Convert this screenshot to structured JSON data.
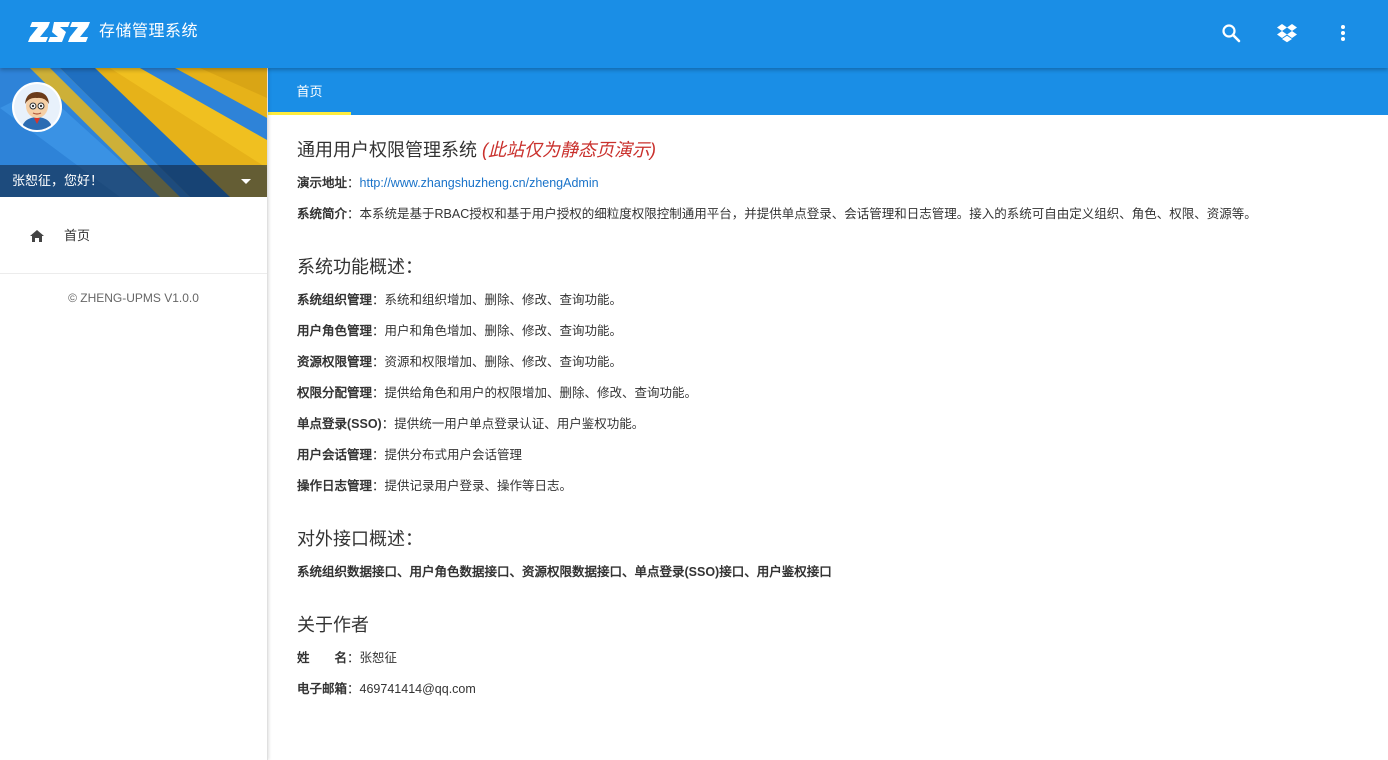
{
  "app": {
    "title": "存储管理系统",
    "logo_text": "ZSZ"
  },
  "topbar": {
    "icons": [
      "search-icon",
      "dropbox-icon",
      "more-vert-icon"
    ]
  },
  "sidebar": {
    "greeting": "张恕征，您好！",
    "nav": [
      {
        "label": "首页",
        "icon": "home-icon"
      }
    ],
    "copyright": "© ZHENG-UPMS V1.0.0"
  },
  "tabs": [
    {
      "label": "首页",
      "active": true
    }
  ],
  "content": {
    "title": "通用用户权限管理系统",
    "title_note": "(此站仅为静态页演示)",
    "demo": {
      "label": "演示地址",
      "sep": "：",
      "url": "http://www.zhangshuzheng.cn/zhengAdmin"
    },
    "intro": {
      "label": "系统简介",
      "sep": "：",
      "text": "本系统是基于RBAC授权和基于用户授权的细粒度权限控制通用平台，并提供单点登录、会话管理和日志管理。接入的系统可自由定义组织、角色、权限、资源等。"
    },
    "features_title": "系统功能概述：",
    "features": [
      {
        "label": "系统组织管理",
        "sep": "：",
        "text": "系统和组织增加、删除、修改、查询功能。"
      },
      {
        "label": "用户角色管理",
        "sep": "：",
        "text": "用户和角色增加、删除、修改、查询功能。"
      },
      {
        "label": "资源权限管理",
        "sep": "：",
        "text": "资源和权限增加、删除、修改、查询功能。"
      },
      {
        "label": "权限分配管理",
        "sep": "：",
        "text": "提供给角色和用户的权限增加、删除、修改、查询功能。"
      },
      {
        "label": "单点登录(SSO)",
        "sep": "：",
        "text": "提供统一用户单点登录认证、用户鉴权功能。"
      },
      {
        "label": "用户会话管理",
        "sep": "：",
        "text": "提供分布式用户会话管理"
      },
      {
        "label": "操作日志管理",
        "sep": "：",
        "text": "提供记录用户登录、操作等日志。"
      }
    ],
    "api_title": "对外接口概述：",
    "api_text": "系统组织数据接口、用户角色数据接口、资源权限数据接口、单点登录(SSO)接口、用户鉴权接口",
    "author_title": "关于作者",
    "author": [
      {
        "label": "姓　　名",
        "sep": "：",
        "text": "张恕征"
      },
      {
        "label": "电子邮箱",
        "sep": "：",
        "text": "469741414@qq.com"
      }
    ]
  },
  "colors": {
    "primary": "#1a8ee6",
    "accent_underline": "#ffec3d",
    "note_red": "#c9302c",
    "link": "#1a73c9"
  }
}
